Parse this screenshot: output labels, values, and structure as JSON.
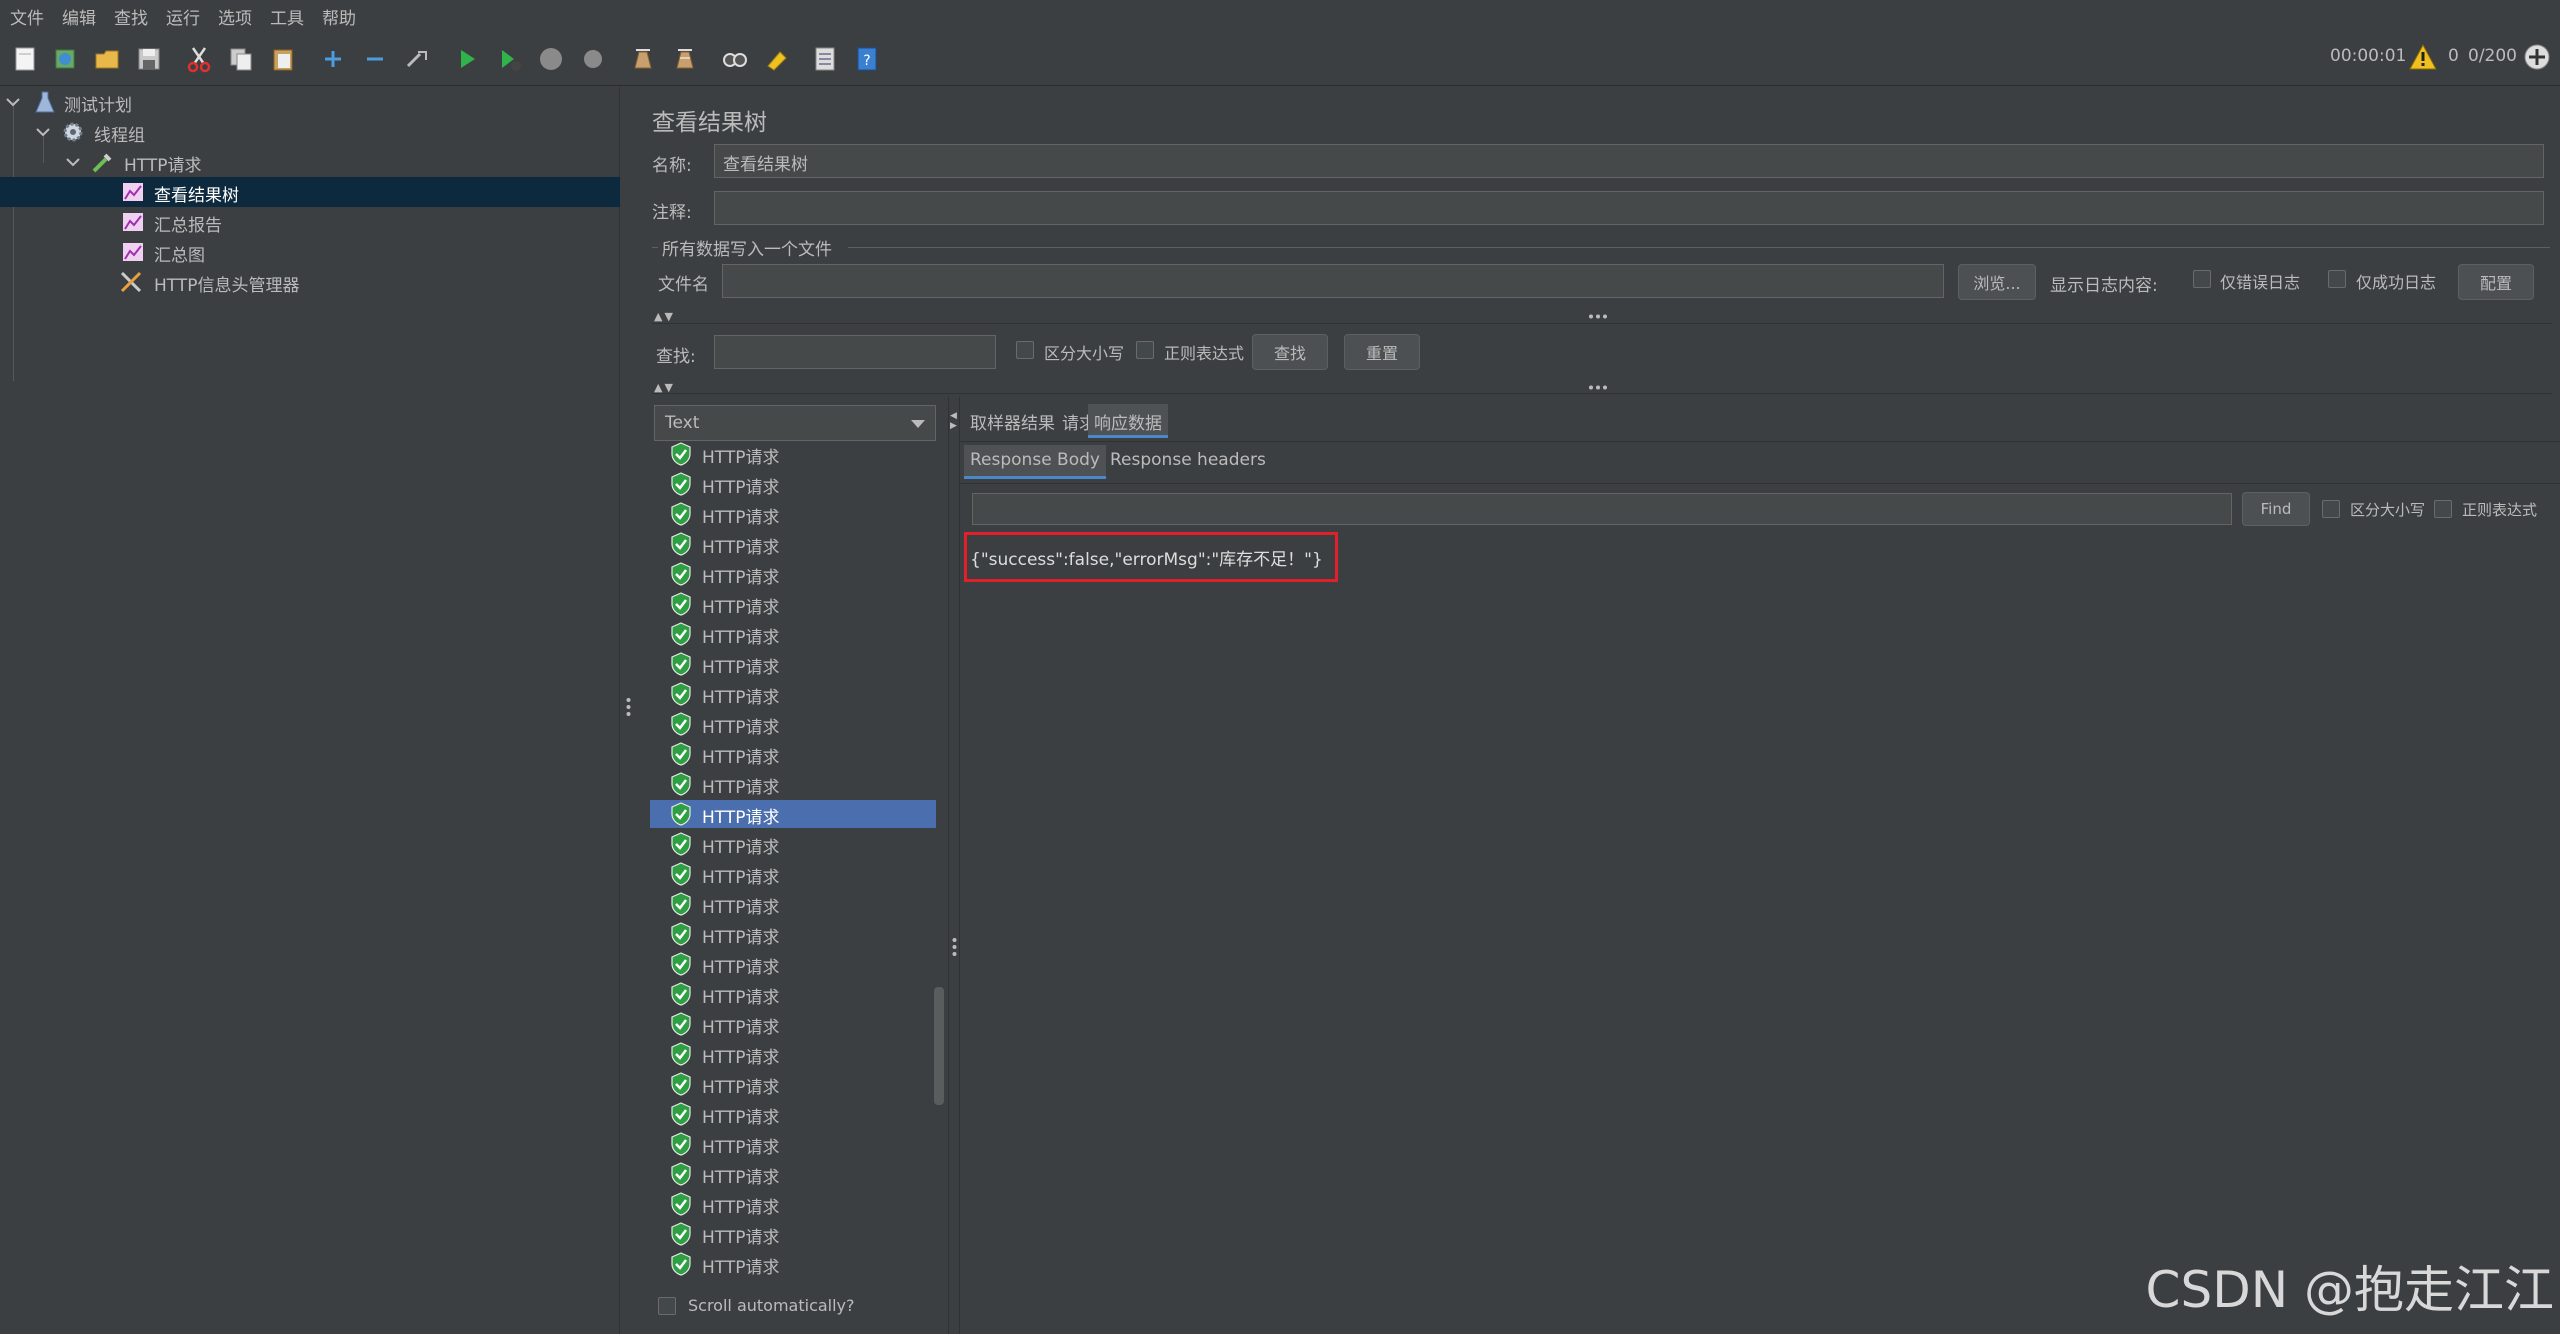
{
  "menu": [
    "文件",
    "编辑",
    "查找",
    "运行",
    "选项",
    "工具",
    "帮助"
  ],
  "toolbar": {
    "elapsed": "00:00:01",
    "warning_count": "0",
    "threads": "0/200"
  },
  "tree": [
    {
      "label": "测试计划",
      "icon": "test-plan-icon"
    },
    {
      "label": "线程组",
      "icon": "gear-icon"
    },
    {
      "label": "HTTP请求",
      "icon": "pipette-icon"
    },
    {
      "label": "查看结果树",
      "icon": "listener-chart-icon"
    },
    {
      "label": "汇总报告",
      "icon": "listener-chart-icon"
    },
    {
      "label": "汇总图",
      "icon": "listener-chart-icon"
    },
    {
      "label": "HTTP信息头管理器",
      "icon": "tools-icon"
    }
  ],
  "panel": {
    "title": "查看结果树",
    "name_label": "名称:",
    "name_value": "查看结果树",
    "comment_label": "注释:",
    "comment_value": "",
    "file_group_title": "所有数据写入一个文件",
    "filename_label": "文件名",
    "browse_button": "浏览...",
    "log_display_label": "显示日志内容:",
    "errors_only_label": "仅错误日志",
    "success_only_label": "仅成功日志",
    "config_button": "配置",
    "search_label": "查找:",
    "case_sensitive_label": "区分大小写",
    "regex_label": "正则表达式",
    "find_button": "查找",
    "reset_button": "重置"
  },
  "results": {
    "renderer": "Text",
    "items": [
      "HTTP请求",
      "HTTP请求",
      "HTTP请求",
      "HTTP请求",
      "HTTP请求",
      "HTTP请求",
      "HTTP请求",
      "HTTP请求",
      "HTTP请求",
      "HTTP请求",
      "HTTP请求",
      "HTTP请求",
      "HTTP请求",
      "HTTP请求",
      "HTTP请求",
      "HTTP请求",
      "HTTP请求",
      "HTTP请求",
      "HTTP请求",
      "HTTP请求",
      "HTTP请求",
      "HTTP请求",
      "HTTP请求",
      "HTTP请求",
      "HTTP请求",
      "HTTP请求",
      "HTTP请求",
      "HTTP请求",
      "HTTP请求"
    ],
    "selected_index": 12,
    "scroll_auto_label": "Scroll automatically?"
  },
  "detail": {
    "tabs": [
      "取样器结果",
      "请求",
      "响应数据"
    ],
    "active_tab": 2,
    "sub_tabs": [
      "Response Body",
      "Response headers"
    ],
    "active_sub_tab": 0,
    "find_button": "Find",
    "case_label": "区分大小写",
    "regex_label": "正则表达式",
    "response_body": "{\"success\":false,\"errorMsg\":\"库存不足！\"}"
  },
  "watermark": "CSDN @抱走江江",
  "colors": {
    "background": "#3c3f41",
    "selection": "#4b6eaf",
    "tree_selection": "#0d293e",
    "highlight_box": "#e0212b",
    "success_green": "#2ea043"
  }
}
